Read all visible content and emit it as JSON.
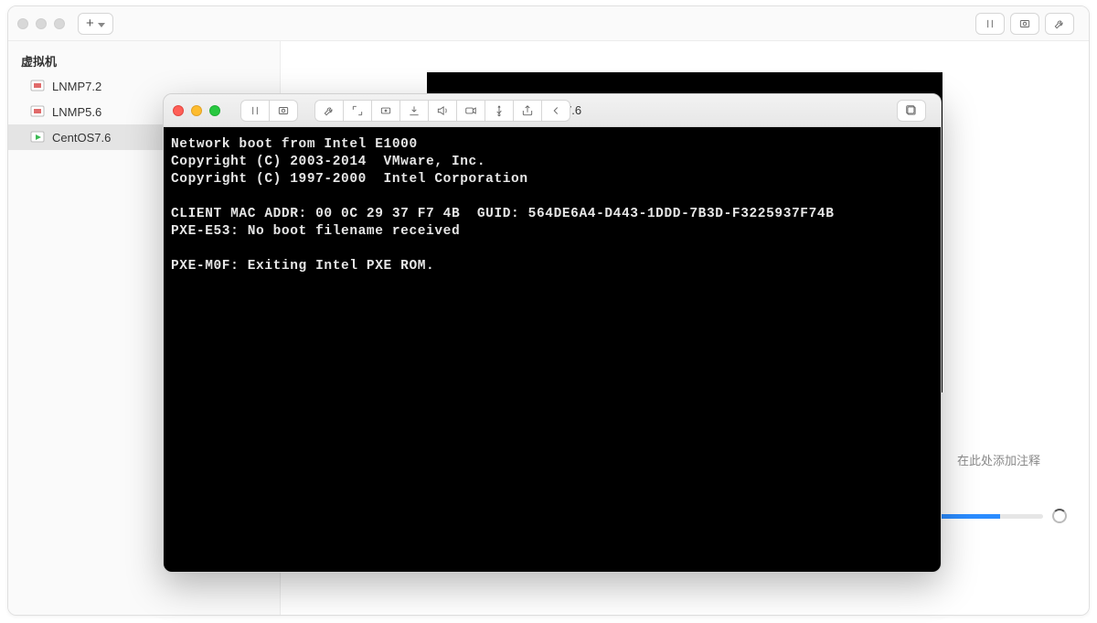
{
  "sidebar": {
    "title": "虚拟机",
    "items": [
      {
        "label": "LNMP7.2",
        "selected": false,
        "state": "off"
      },
      {
        "label": "LNMP5.6",
        "selected": false,
        "state": "off"
      },
      {
        "label": "CentOS7.6",
        "selected": true,
        "state": "on"
      }
    ]
  },
  "notes_placeholder": "在此处添加注释",
  "progress_percent": 65,
  "vm_window": {
    "title": "CentOS7.6"
  },
  "console_lines": [
    "Network boot from Intel E1000",
    "Copyright (C) 2003-2014  VMware, Inc.",
    "Copyright (C) 1997-2000  Intel Corporation",
    "",
    "CLIENT MAC ADDR: 00 0C 29 37 F7 4B  GUID: 564DE6A4-D443-1DDD-7B3D-F3225937F74B",
    "PXE-E53: No boot filename received",
    "",
    "PXE-M0F: Exiting Intel PXE ROM."
  ],
  "icons": {
    "add": "add-icon",
    "pause": "pause-icon",
    "snapshot": "snapshot-icon",
    "wrench": "wrench-icon",
    "resize": "resize-icon",
    "disk": "disk-icon",
    "insert": "insert-icon",
    "sound": "sound-icon",
    "camera": "camera-icon",
    "usb": "usb-icon",
    "share": "share-icon",
    "back": "back-icon",
    "expand": "expand-icon"
  }
}
